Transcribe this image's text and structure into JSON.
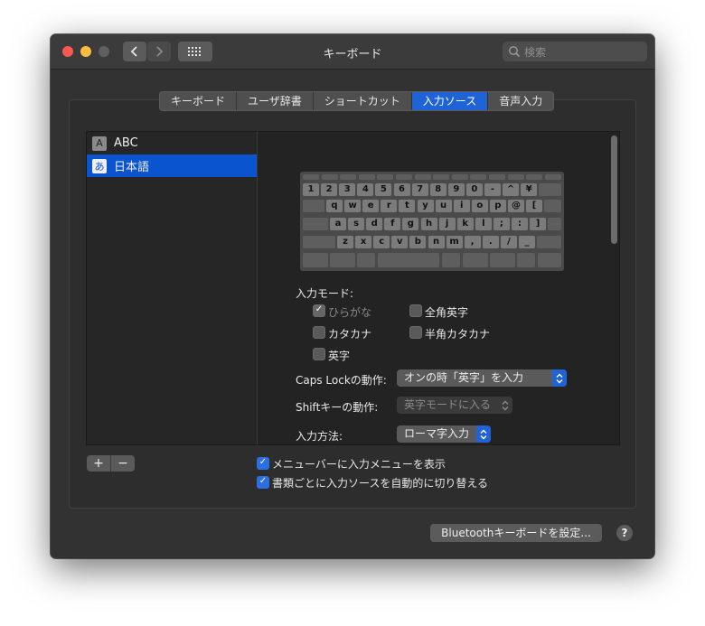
{
  "window": {
    "title": "キーボード",
    "search_placeholder": "検索"
  },
  "tabs": [
    {
      "label": "キーボード",
      "active": false
    },
    {
      "label": "ユーザ辞書",
      "active": false
    },
    {
      "label": "ショートカット",
      "active": false
    },
    {
      "label": "入力ソース",
      "active": true
    },
    {
      "label": "音声入力",
      "active": false
    }
  ],
  "sources": [
    {
      "icon": "A",
      "label": "ABC",
      "selected": false
    },
    {
      "icon": "あ",
      "label": "日本語",
      "selected": true
    }
  ],
  "keyboard_rows": [
    [
      "1",
      "2",
      "3",
      "4",
      "5",
      "6",
      "7",
      "8",
      "9",
      "0",
      "-",
      "^",
      "¥"
    ],
    [
      "q",
      "w",
      "e",
      "r",
      "t",
      "y",
      "u",
      "i",
      "o",
      "p",
      "@",
      "["
    ],
    [
      "a",
      "s",
      "d",
      "f",
      "g",
      "h",
      "j",
      "k",
      "l",
      ";",
      ":",
      "]"
    ],
    [
      "z",
      "x",
      "c",
      "v",
      "b",
      "n",
      "m",
      ",",
      ".",
      "/",
      "_"
    ]
  ],
  "input_mode": {
    "label": "入力モード:",
    "options": {
      "hiragana": "ひらがな",
      "zenkaku_eiji": "全角英字",
      "katakana": "カタカナ",
      "hankaku_katakana": "半角カタカナ",
      "eiji": "英字"
    }
  },
  "caps_lock": {
    "label": "Caps Lockの動作:",
    "value": "オンの時「英字」を入力"
  },
  "shift": {
    "label": "Shiftキーの動作:",
    "value": "英字モードに入る"
  },
  "input_method": {
    "label": "入力方法:",
    "value": "ローマ字入力"
  },
  "options": {
    "show_menu": "メニューバーに入力メニューを表示",
    "auto_switch": "書類ごとに入力ソースを自動的に切り替える"
  },
  "buttons": {
    "add": "+",
    "remove": "−",
    "bluetooth": "Bluetoothキーボードを設定...",
    "help": "?"
  },
  "colors": {
    "accent": "#1f63d6",
    "selection": "#0a55cf",
    "close": "#fc5753",
    "minimize": "#fdbc40"
  }
}
